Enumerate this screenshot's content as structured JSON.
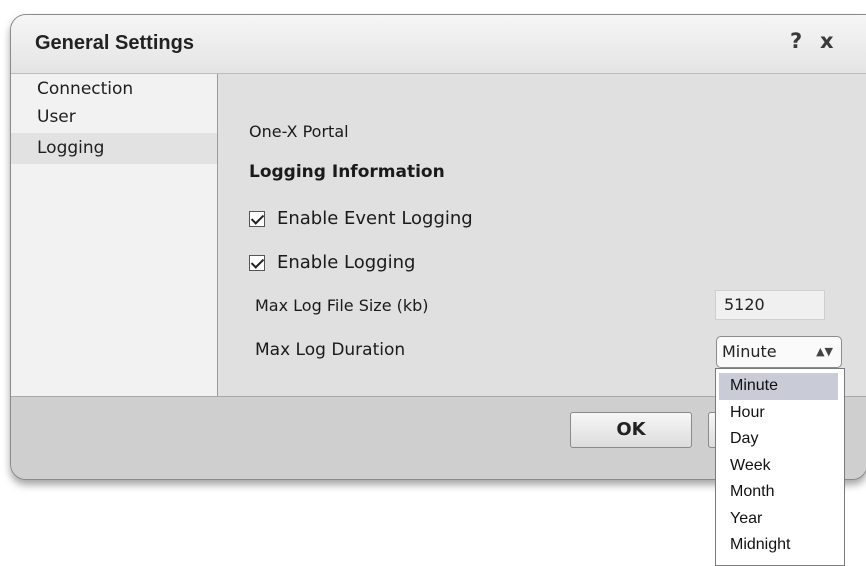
{
  "dialog": {
    "title": "General Settings",
    "help_glyph": "?",
    "close_glyph": "x"
  },
  "sidebar": {
    "items": [
      {
        "label": "Connection"
      },
      {
        "label": "User"
      },
      {
        "label": "Logging",
        "selected": true
      }
    ]
  },
  "content": {
    "subtitle": "One-X Portal",
    "section_title": "Logging Information",
    "enable_event_logging": {
      "label": "Enable Event Logging",
      "checked": true
    },
    "enable_logging": {
      "label": "Enable Logging",
      "checked": true
    },
    "max_log_file_size": {
      "label": "Max Log File Size (kb)",
      "value": "5120"
    },
    "max_log_duration": {
      "label": "Max Log Duration",
      "selected": "Minute"
    }
  },
  "dropdown": {
    "options": [
      "Minute",
      "Hour",
      "Day",
      "Week",
      "Month",
      "Year",
      "Midnight"
    ],
    "highlighted": "Minute"
  },
  "footer": {
    "ok_label": "OK"
  },
  "colors": {
    "dialog_bg": "#d9d9d9",
    "sidebar_bg": "#f2f2f2",
    "selected_option_bg": "#c9cbd6"
  }
}
